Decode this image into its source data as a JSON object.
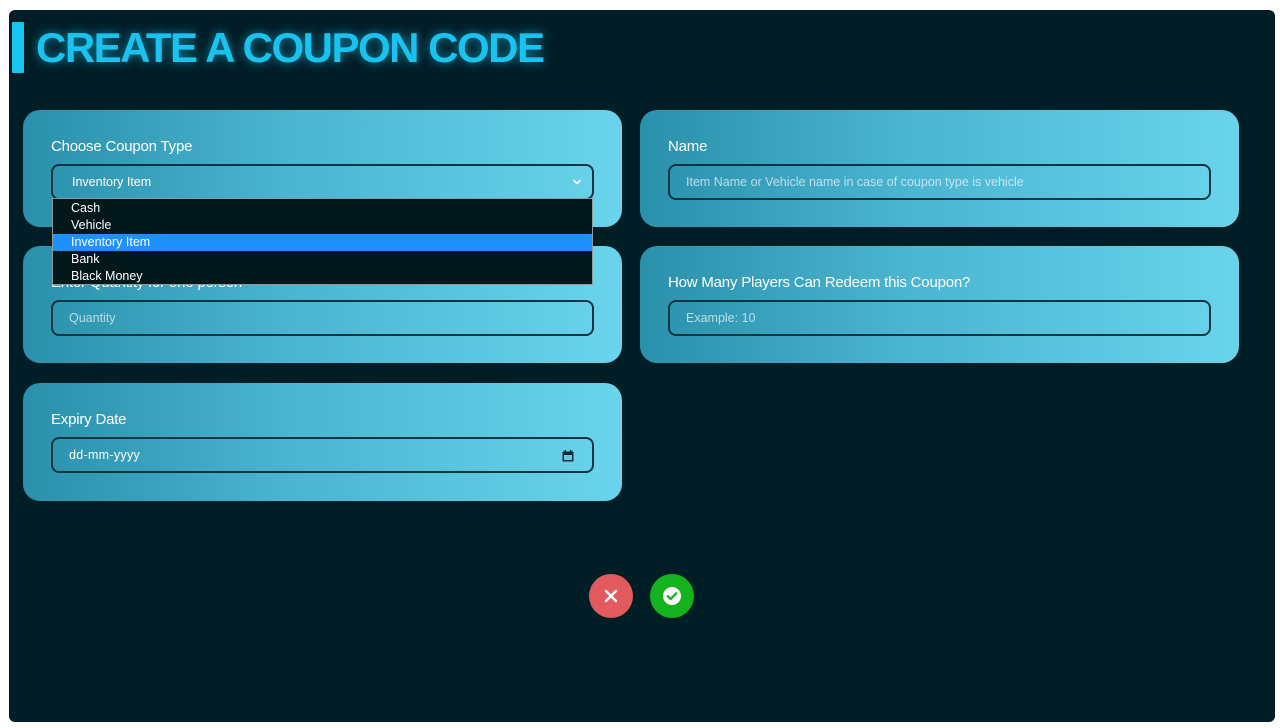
{
  "header": {
    "title": "CREATE A COUPON CODE"
  },
  "form": {
    "coupon_type": {
      "label": "Choose Coupon Type",
      "selected": "Inventory Item",
      "options": [
        "Cash",
        "Vehicle",
        "Inventory Item",
        "Bank",
        "Black Money"
      ]
    },
    "name": {
      "label": "Name",
      "placeholder": "Item Name or Vehicle name in case of coupon type is vehicle"
    },
    "quantity": {
      "label": "Enter Quantity for one person",
      "placeholder": "Quantity"
    },
    "players": {
      "label": "How Many Players Can Redeem this Coupon?",
      "placeholder": "Example: 10"
    },
    "expiry": {
      "label": "Expiry Date",
      "value": "dd-mm-yyyy"
    }
  },
  "actions": {
    "cancel_icon": "close-icon",
    "confirm_icon": "check-circle-icon"
  },
  "colors": {
    "background": "#001e26",
    "accent": "#19c3f0",
    "card_gradient_start": "#2a90ab",
    "card_gradient_end": "#69d4eb",
    "option_highlight": "#1e90ff",
    "cancel": "#e25a5e",
    "confirm": "#13b21e"
  }
}
